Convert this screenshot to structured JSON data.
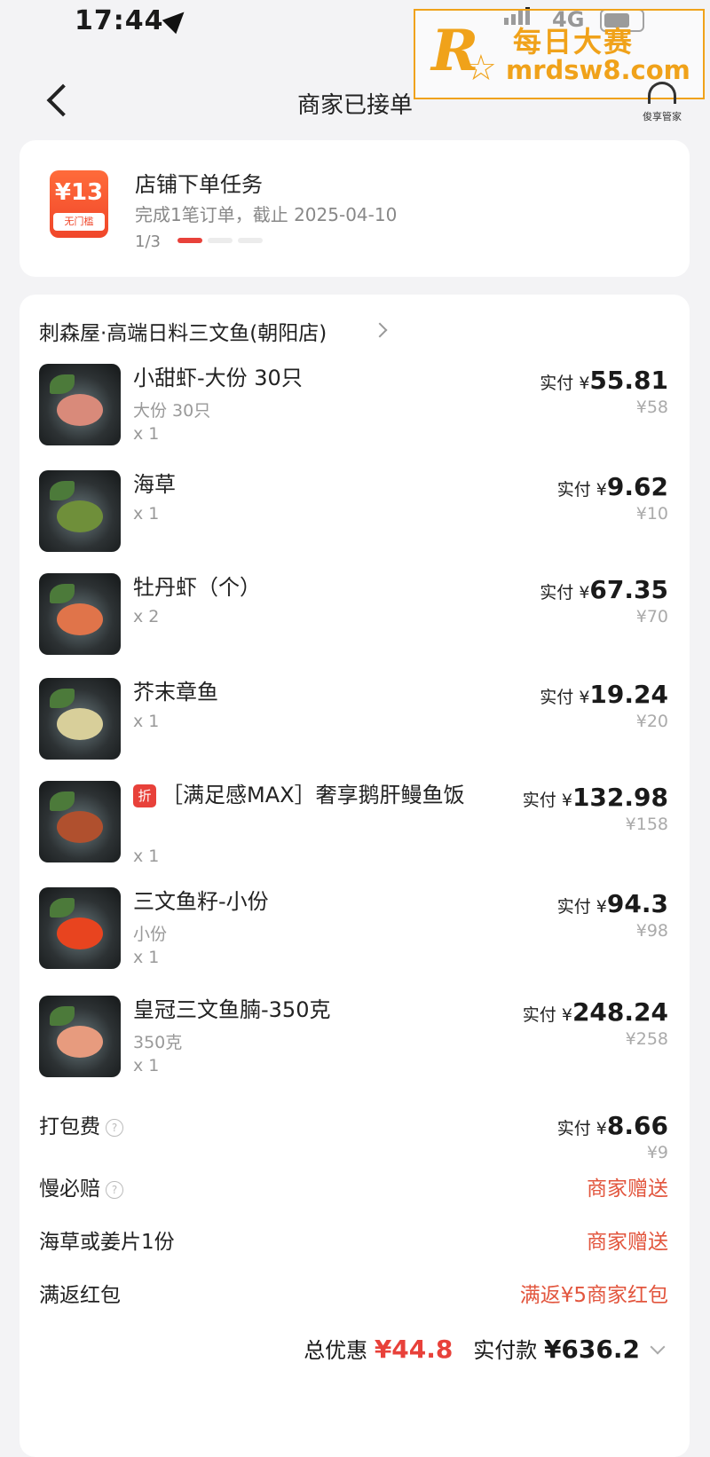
{
  "status_bar": {
    "time": "17:44",
    "network": "4G"
  },
  "watermark": {
    "cn": "每日大赛",
    "url": "mrdsw8.com",
    "logo_letter": "R"
  },
  "nav": {
    "title": "商家已接单",
    "service_label": "俊享管家"
  },
  "task": {
    "icon_amount": "¥13",
    "icon_sub": "无门槛",
    "title": "店铺下单任务",
    "desc": "完成1笔订单，截止 2025-04-10",
    "progress": "1/3",
    "progress_value": 1,
    "progress_total": 3
  },
  "order": {
    "shop": "刺森屋·高端日料三文鱼(朝阳店)",
    "items": [
      {
        "name": "小甜虾-大份 30只",
        "spec": "大份 30只",
        "qty": "x 1",
        "pay_label": "实付 ¥",
        "pay": "55.81",
        "orig": "¥58",
        "tag": "",
        "food_color": "#d98a7a"
      },
      {
        "name": "海草",
        "spec": "",
        "qty": "x 1",
        "pay_label": "实付 ¥",
        "pay": "9.62",
        "orig": "¥10",
        "tag": "",
        "food_color": "#6f8f3a"
      },
      {
        "name": "牡丹虾（个）",
        "spec": "",
        "qty": "x 2",
        "pay_label": "实付 ¥",
        "pay": "67.35",
        "orig": "¥70",
        "tag": "",
        "food_color": "#e0744a"
      },
      {
        "name": "芥末章鱼",
        "spec": "",
        "qty": "x 1",
        "pay_label": "实付 ¥",
        "pay": "19.24",
        "orig": "¥20",
        "tag": "",
        "food_color": "#d8cf9a"
      },
      {
        "name": "［满足感MAX］奢享鹅肝鳗鱼饭",
        "spec": "",
        "qty": "x 1",
        "pay_label": "实付 ¥",
        "pay": "132.98",
        "orig": "¥158",
        "tag": "折",
        "food_color": "#b0502e"
      },
      {
        "name": "三文鱼籽-小份",
        "spec": "小份",
        "qty": "x 1",
        "pay_label": "实付 ¥",
        "pay": "94.3",
        "orig": "¥98",
        "tag": "",
        "food_color": "#e8441f"
      },
      {
        "name": "皇冠三文鱼腩-350克",
        "spec": "350克",
        "qty": "x 1",
        "pay_label": "实付 ¥",
        "pay": "248.24",
        "orig": "¥258",
        "tag": "",
        "food_color": "#e79b7e"
      }
    ],
    "fees": [
      {
        "label": "打包费",
        "help": true,
        "pay_label": "实付 ¥",
        "pay": "8.66",
        "orig": "¥9",
        "note": ""
      },
      {
        "label": "慢必赔",
        "help": true,
        "note": "商家赠送"
      },
      {
        "label": "海草或姜片1份",
        "help": false,
        "note": "商家赠送"
      },
      {
        "label": "满返红包",
        "help": false,
        "note": "满返¥5商家红包"
      }
    ],
    "summary": {
      "discount_label": "总优惠",
      "discount": "¥44.8",
      "paid_label": "实付款",
      "paid": "¥636.2"
    }
  },
  "colors": {
    "accent": "#e8413a",
    "gift": "#e2553d",
    "watermark": "#f0a21a"
  }
}
